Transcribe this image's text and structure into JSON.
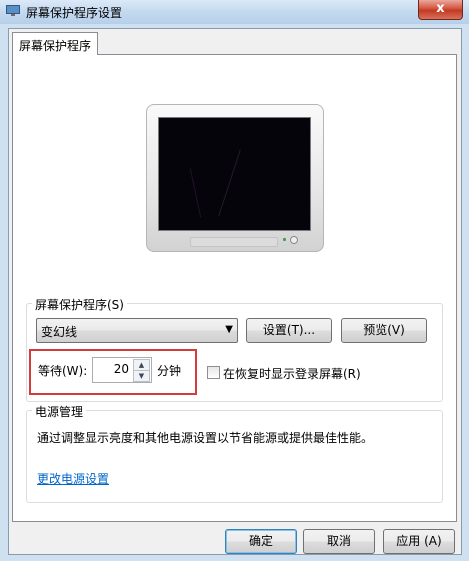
{
  "window": {
    "title": "屏幕保护程序设置",
    "close_label": "x"
  },
  "tabs": [
    {
      "label": "屏幕保护程序"
    }
  ],
  "screensaver": {
    "group_label": "屏幕保护程序(S)",
    "selected": "变幻线",
    "settings_button": "设置(T)...",
    "preview_button": "预览(V)",
    "wait_label": "等待(W):",
    "wait_value": "20",
    "wait_unit": "分钟",
    "resume_checkbox_label": "在恢复时显示登录屏幕(R)",
    "resume_checked": false
  },
  "power": {
    "group_label": "电源管理",
    "description": "通过调整显示亮度和其他电源设置以节省能源或提供最佳性能。",
    "link": "更改电源设置"
  },
  "footer": {
    "ok": "确定",
    "cancel": "取消",
    "apply": "应用 (A)"
  },
  "colors": {
    "highlight_box": "#d43b3b",
    "link": "#0066cc",
    "close_button": "#c23a22"
  }
}
